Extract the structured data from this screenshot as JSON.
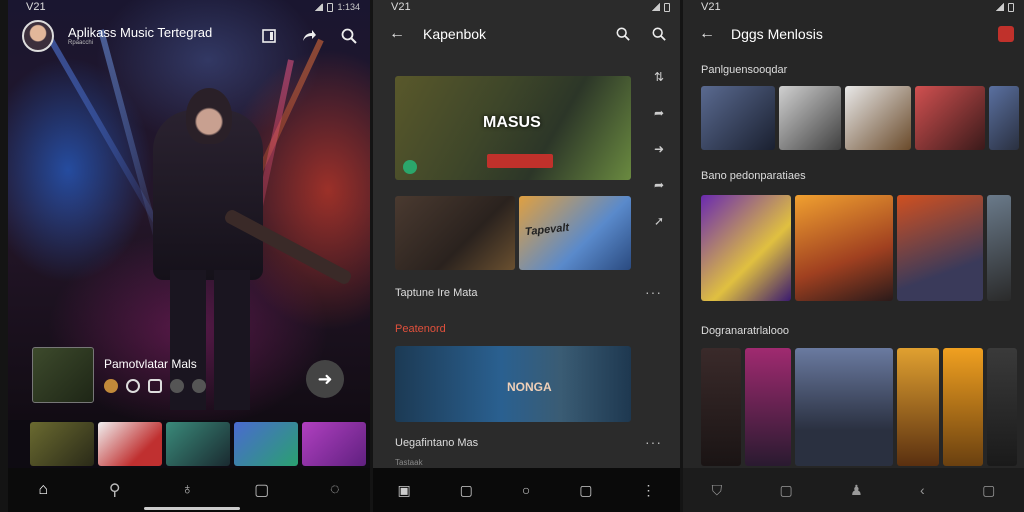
{
  "panel1": {
    "status_time": "V21",
    "status_right": "1:134",
    "title": "Aplikass Music Tertegrad",
    "subtitle": "Rpaacchi",
    "now_playing": "Pamotvlatar Mals",
    "nav": [
      "home-icon",
      "search-icon",
      "library-icon",
      "square-icon",
      "chat-icon"
    ]
  },
  "panel2": {
    "status_time": "V21",
    "title": "Kapenbok",
    "featured_title": "MASUS",
    "card_b_title": "Tapevalt",
    "section1": "Taptune Ire Mata",
    "section2": "Peatenord",
    "card_c_title": "NONGA",
    "section3": "Uegafintano Mas",
    "section4": "Tastaak",
    "more": "···"
  },
  "panel3": {
    "status_time": "V21",
    "title": "Dggs Menlosis",
    "section1": "Panlguensooqdar",
    "section2": "Bano pedonparatiaes",
    "section3": "Dogranaratrlalooo"
  }
}
